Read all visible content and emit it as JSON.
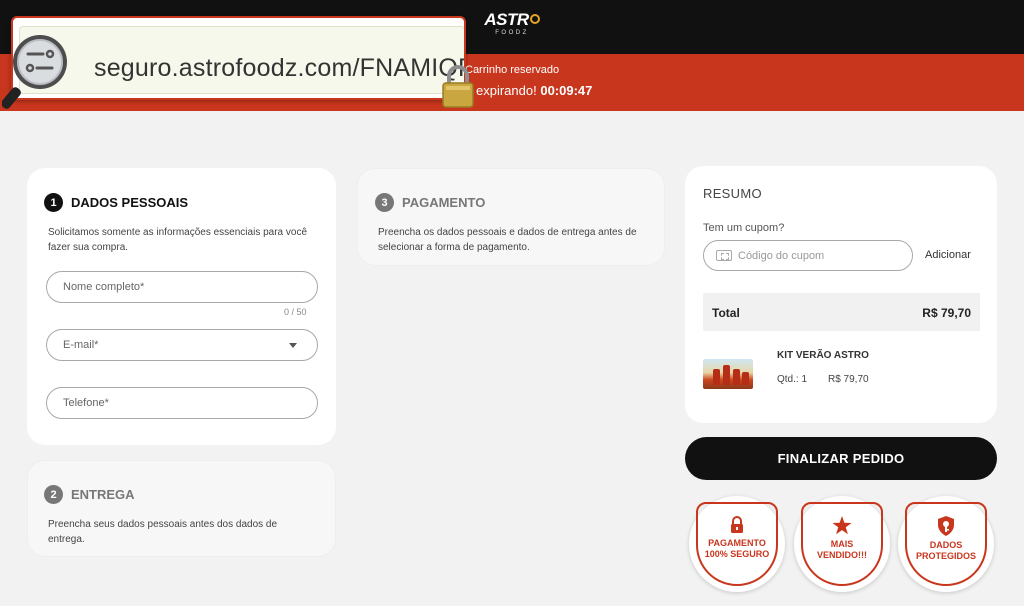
{
  "header": {
    "logo_text": "ASTR",
    "logo_sub": "FOODZ",
    "reserved_text": "Carrinho reservado",
    "expiring_text": "expirando!",
    "timer": "00:09:47"
  },
  "url_bar": {
    "url": "seguro.astrofoodz.com/FNAMIQRF"
  },
  "personal": {
    "step": "1",
    "title": "DADOS PESSOAIS",
    "description_line1": "Solicitamos somente as informações essenciais para você",
    "description_line2": "fazer sua compra.",
    "name_placeholder": "Nome completo*",
    "name_counter": "0 / 50",
    "email_placeholder": "E-mail*",
    "phone_placeholder": "Telefone*"
  },
  "delivery": {
    "step": "2",
    "title": "ENTREGA",
    "description_line1": "Preencha seus dados pessoais antes dos dados de",
    "description_line2": "entrega."
  },
  "payment": {
    "step": "3",
    "title": "PAGAMENTO",
    "description_line1": "Preencha os dados pessoais e dados de entrega antes de",
    "description_line2": "selecionar a forma de pagamento."
  },
  "summary": {
    "title": "RESUMO",
    "coupon_question": "Tem um cupom?",
    "coupon_placeholder": "Código do cupom",
    "coupon_button": "Adicionar",
    "total_label": "Total",
    "total_value": "R$ 79,70",
    "product_name": "KIT VERÃO ASTRO",
    "product_qty": "Qtd.: 1",
    "product_price": "R$ 79,70"
  },
  "actions": {
    "finalize_label": "FINALIZAR PEDIDO"
  },
  "badges": [
    {
      "line1": "PAGAMENTO",
      "line2": "100% SEGURO",
      "icon": "lock-icon"
    },
    {
      "line1": "MAIS",
      "line2": "VENDIDO!!!",
      "icon": "star-icon"
    },
    {
      "line1": "DADOS",
      "line2": "PROTEGIDOS",
      "icon": "key-shield-icon"
    }
  ],
  "colors": {
    "accent_red": "#c8361d",
    "dark": "#111111",
    "logo_ring": "#e6a329"
  }
}
